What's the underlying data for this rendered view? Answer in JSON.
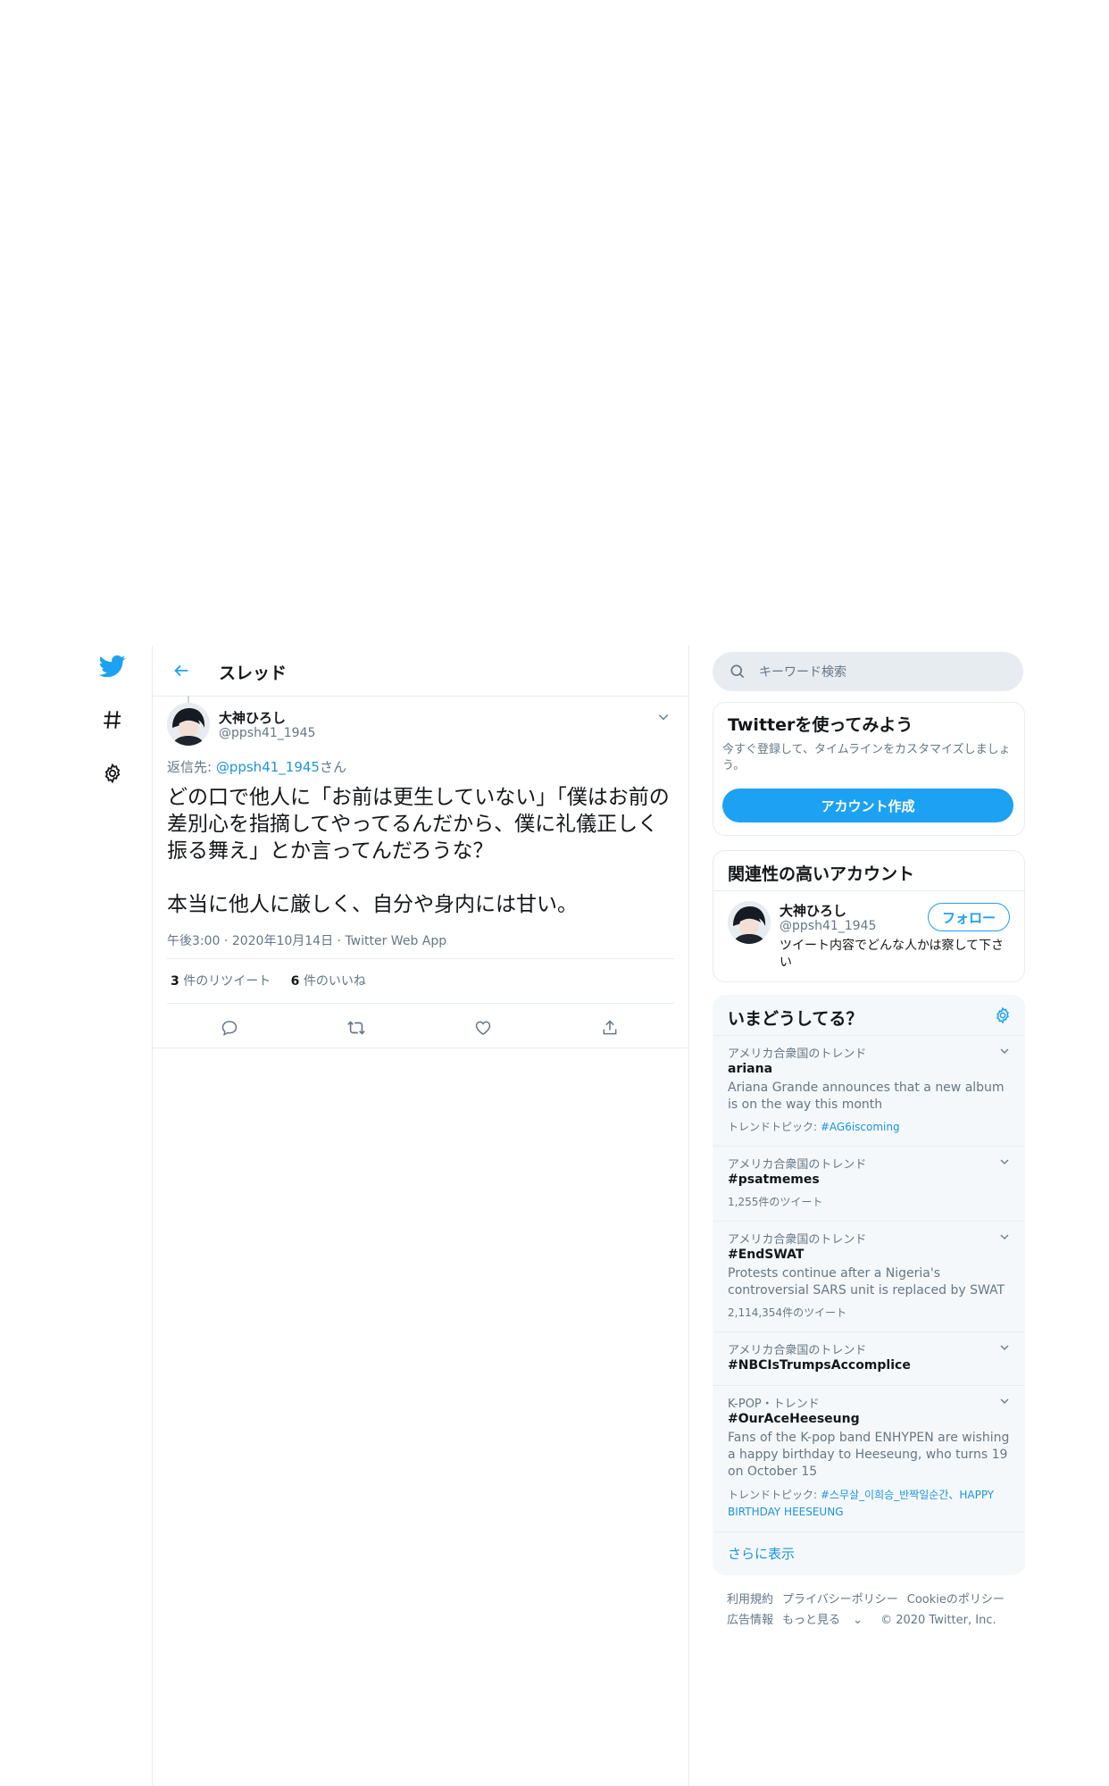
{
  "colors": {
    "accent": "#1da1f2",
    "link": "#1b95e0",
    "secondary_text": "#657786",
    "border": "#e6ecf0",
    "trend_bg": "#f5f8fa"
  },
  "nav": {
    "icons": [
      "twitter-logo-icon",
      "hashtag-icon",
      "gear-icon"
    ]
  },
  "header": {
    "back_icon": "arrow-left-icon",
    "title": "スレッド"
  },
  "tweet": {
    "author_name": "大神ひろし",
    "author_handle": "@ppsh41_1945",
    "reply_prefix": "返信先: ",
    "reply_handle": "@ppsh41_1945",
    "reply_suffix": "さん",
    "text": "どの口で他人に「お前は更生していない」「僕はお前の差別心を指摘してやってるんだから、僕に礼儀正しく振る舞え」とか言ってんだろうな？\n\n本当に他人に厳しく、自分や身内には甘い。",
    "time": "午後3:00",
    "date": "2020年10月14日",
    "source": "Twitter Web App",
    "retweet_count": "3",
    "retweet_label": " 件のリツイート",
    "like_count": "6",
    "like_label": " 件のいいね",
    "actions": [
      "reply-icon",
      "retweet-icon",
      "like-icon",
      "share-icon"
    ]
  },
  "search": {
    "placeholder": "キーワード検索"
  },
  "signup": {
    "title": "Twitterを使ってみよう",
    "description": "今すぐ登録して、タイムラインをカスタマイズしましょう。",
    "button": "アカウント作成"
  },
  "related": {
    "title": "関連性の高いアカウント",
    "name": "大神ひろし",
    "handle": "@ppsh41_1945",
    "follow": "フォロー",
    "bio": "ツイート内容でどんな人かは察して下さい"
  },
  "trends": {
    "title": "いまどうしてる？",
    "items": [
      {
        "context": "アメリカ合衆国のトレンド",
        "name": "ariana",
        "description": "Ariana Grande announces that a new album is on the way this month",
        "meta_prefix": "トレンドトピック: ",
        "meta_link": "#AG6iscoming"
      },
      {
        "context": "アメリカ合衆国のトレンド",
        "name": "#psatmemes",
        "count": "1,255件のツイート"
      },
      {
        "context": "アメリカ合衆国のトレンド",
        "name": "#EndSWAT",
        "description": "Protests continue after a Nigeria's controversial SARS unit is replaced by SWAT",
        "count": "2,114,354件のツイート"
      },
      {
        "context": "アメリカ合衆国のトレンド",
        "name": "#NBCIsTrumpsAccomplice"
      },
      {
        "context": "K-POP・トレンド",
        "name": "#OurAceHeeseung",
        "description": "Fans of the K-pop band ENHYPEN are wishing a happy birthday to Heeseung, who turns 19 on October 15",
        "meta_prefix": "トレンドトピック: ",
        "meta_link": "#스무살_이희승_반짝일순간、HAPPY BIRTHDAY HEESEUNG"
      }
    ],
    "show_more": "さらに表示"
  },
  "footer": {
    "terms": "利用規約",
    "privacy": "プライバシーポリシー",
    "cookie": "Cookieのポリシー",
    "ads": "広告情報",
    "more": "もっと見る",
    "copyright": "© 2020 Twitter, Inc."
  }
}
